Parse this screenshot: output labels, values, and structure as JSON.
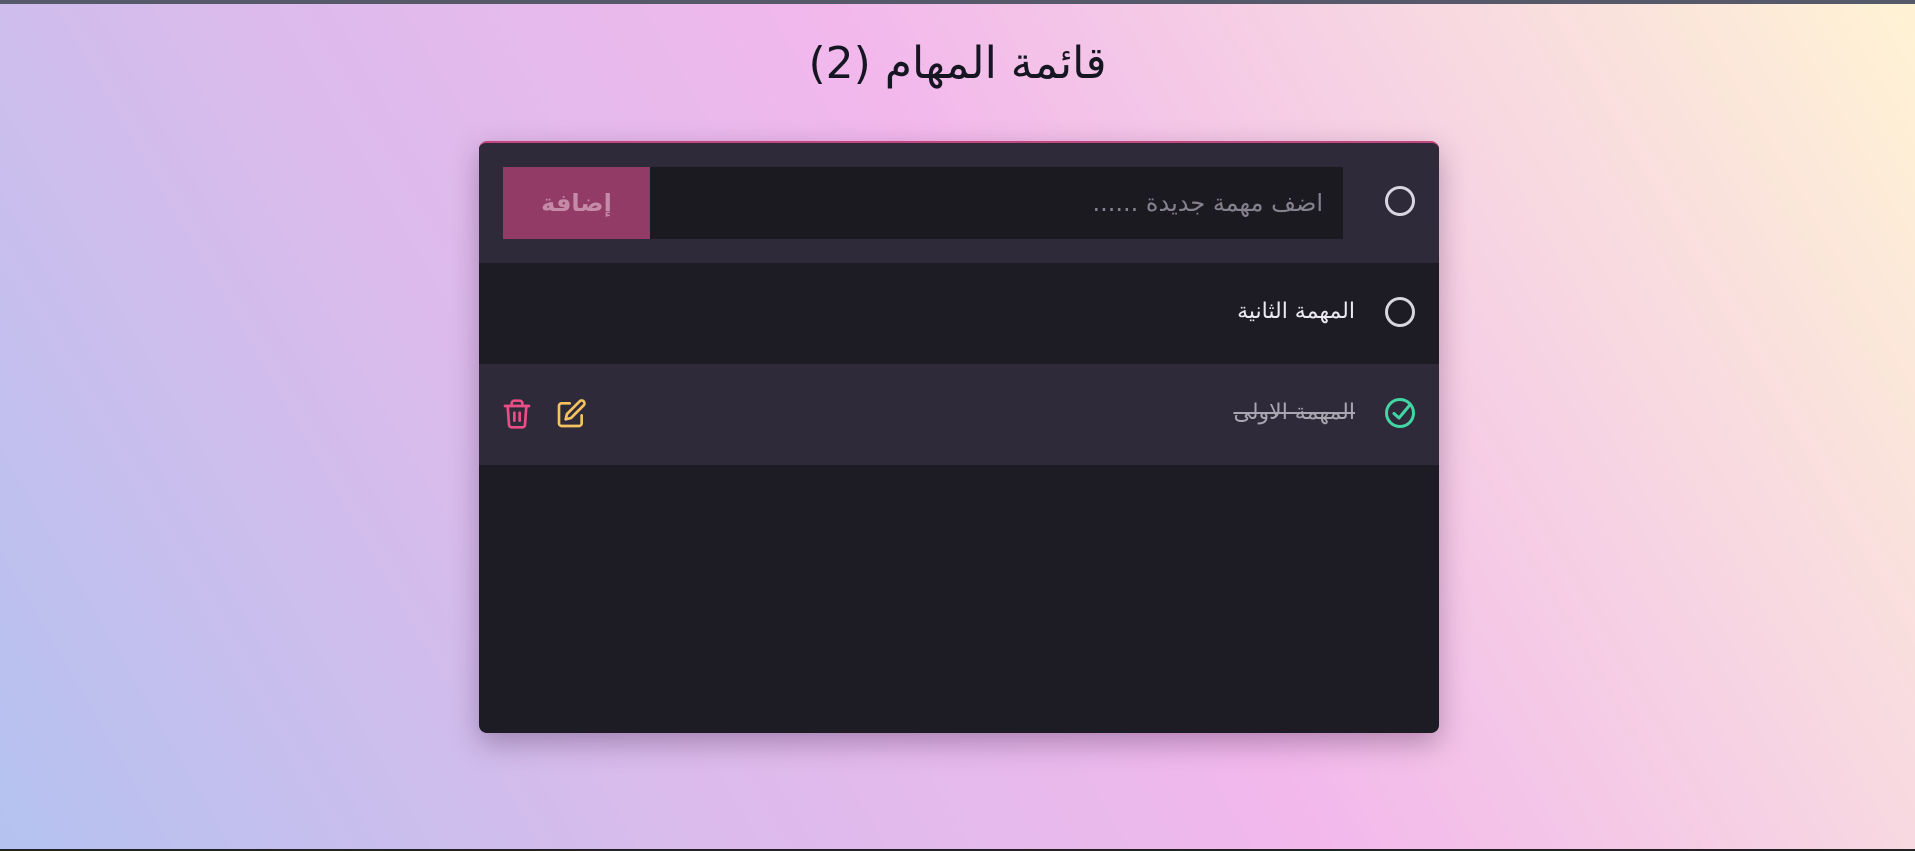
{
  "header": {
    "title": "قائمة المهام (2)"
  },
  "new_task": {
    "placeholder": "اضف مهمة جديدة ......",
    "value": "",
    "add_label": "إضافة"
  },
  "tasks": [
    {
      "label": "المهمة الثانية",
      "completed": false
    },
    {
      "label": "المهمة الاولى",
      "completed": true
    }
  ],
  "icons": {
    "task_checkbox": "circle-icon",
    "completed_checkbox": "check-circle-icon",
    "edit": "edit-icon",
    "delete": "trash-icon"
  },
  "colors": {
    "accent": "#913b66",
    "done": "#41d6a2",
    "edit": "#f4c25f",
    "delete": "#ea4e86"
  }
}
